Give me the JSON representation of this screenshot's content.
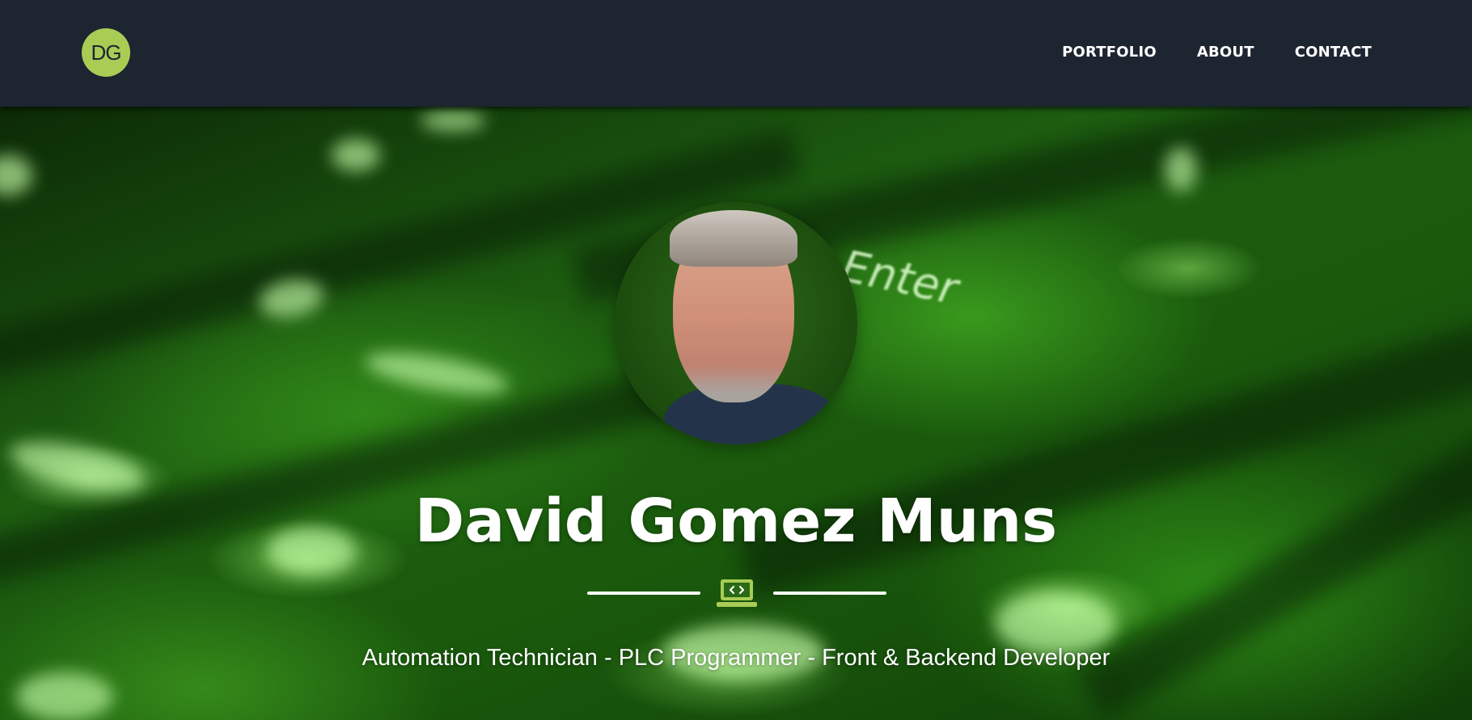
{
  "nav": {
    "logo_text": "DG",
    "links": [
      "PORTFOLIO",
      "ABOUT",
      "CONTACT"
    ]
  },
  "hero": {
    "background_text": "Enter",
    "name": "David Gomez Muns",
    "divider_icon": "laptop-code-icon",
    "subtitle": "Automation Technician - PLC Programmer - Front & Backend Developer"
  },
  "colors": {
    "navbar": "#1c2530",
    "accent": "#a9cc55",
    "text": "#ffffff",
    "hero_green": "#1d5e10"
  }
}
